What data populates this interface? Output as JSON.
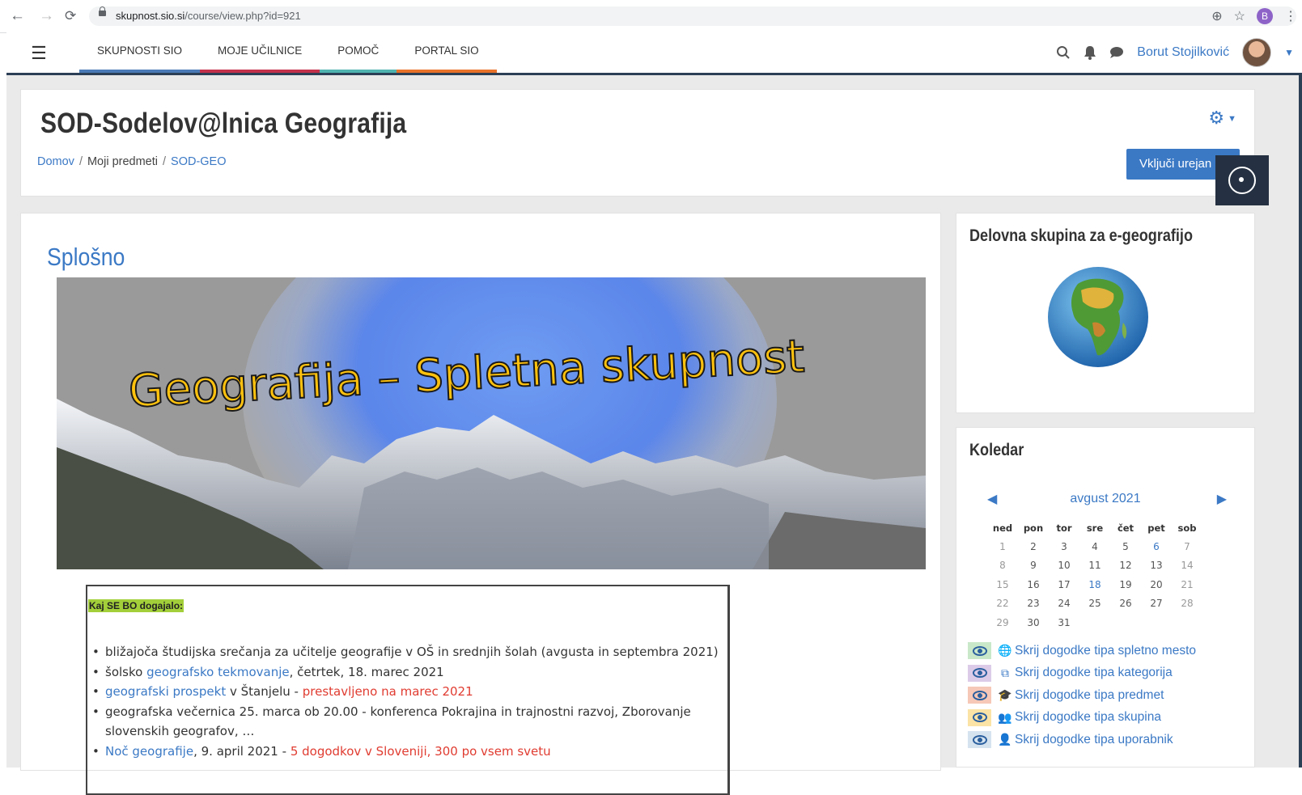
{
  "browser": {
    "url_host": "skupnost.sio.si",
    "url_path": "/course/view.php?id=921",
    "profile_initial": "B"
  },
  "navbar": {
    "links": [
      "SKUPNOSTI SIO",
      "MOJE UČILNICE",
      "POMOČ",
      "PORTAL SIO"
    ],
    "user_name": "Borut Stojilković"
  },
  "header": {
    "title": "SOD-Sodelov@lnica Geografija",
    "breadcrumb": [
      "Domov",
      "Moji predmeti",
      "SOD-GEO"
    ],
    "edit_button": "Vključi urejan"
  },
  "section": {
    "title": "Splošno",
    "banner_text": "Geografija – Spletna skupnost"
  },
  "infobox": {
    "heading": "Kaj SE BO dogajalo:",
    "items": [
      {
        "a": "bližajoča študijska srečanja za učitelje geografije v OŠ in srednjih šolah (avgusta in septembra 2021)"
      },
      {
        "a": "šolsko ",
        "link": "geografsko tekmovanje",
        "b": ", četrtek, 18. marec 2021"
      },
      {
        "link": "geografski prospekt",
        "b": " v Štanjelu - ",
        "red": "prestavljeno na marec 2021"
      },
      {
        "a": "geografska večernica 25. marca ob 20.00 - konferenca Pokrajina in trajnostni razvoj, Zborovanje slovenskih geografov, …"
      },
      {
        "link": "Noč geografije",
        "b": ", 9. april 2021 - ",
        "red": "5 dogodkov v Sloveniji, 300 po vsem svetu"
      }
    ]
  },
  "group_block": {
    "title": "Delovna skupina za e-geografijo"
  },
  "calendar": {
    "title": "Koledar",
    "month": "avgust 2021",
    "weekdays": [
      "ned",
      "pon",
      "tor",
      "sre",
      "čet",
      "pet",
      "sob"
    ],
    "weeks": [
      [
        "1",
        "2",
        "3",
        "4",
        "5",
        "6",
        "7"
      ],
      [
        "8",
        "9",
        "10",
        "11",
        "12",
        "13",
        "14"
      ],
      [
        "15",
        "16",
        "17",
        "18",
        "19",
        "20",
        "21"
      ],
      [
        "22",
        "23",
        "24",
        "25",
        "26",
        "27",
        "28"
      ],
      [
        "29",
        "30",
        "31",
        "",
        "",
        "",
        ""
      ]
    ],
    "event_days": [
      "6",
      "18"
    ],
    "filters": [
      {
        "label": "Skrij dogodke tipa spletno mesto",
        "bg": "#c9e8c9",
        "icon": "globe-icon",
        "glyph": "🌐"
      },
      {
        "label": "Skrij dogodke tipa kategorija",
        "bg": "#dccbe8",
        "icon": "cubes-icon",
        "glyph": "⧉"
      },
      {
        "label": "Skrij dogodke tipa predmet",
        "bg": "#f6c8b7",
        "icon": "graduation-cap-icon",
        "glyph": "🎓"
      },
      {
        "label": "Skrij dogodke tipa skupina",
        "bg": "#fbe3a6",
        "icon": "users-icon",
        "glyph": "👥"
      },
      {
        "label": "Skrij dogodke tipa uporabnik",
        "bg": "#d5e3ef",
        "icon": "user-icon",
        "glyph": "👤"
      }
    ]
  },
  "colors": {
    "link": "#3b79c5",
    "navbar_border": "#2b3f55",
    "highlight": "#a3cf3a",
    "alert": "#e03c31"
  }
}
